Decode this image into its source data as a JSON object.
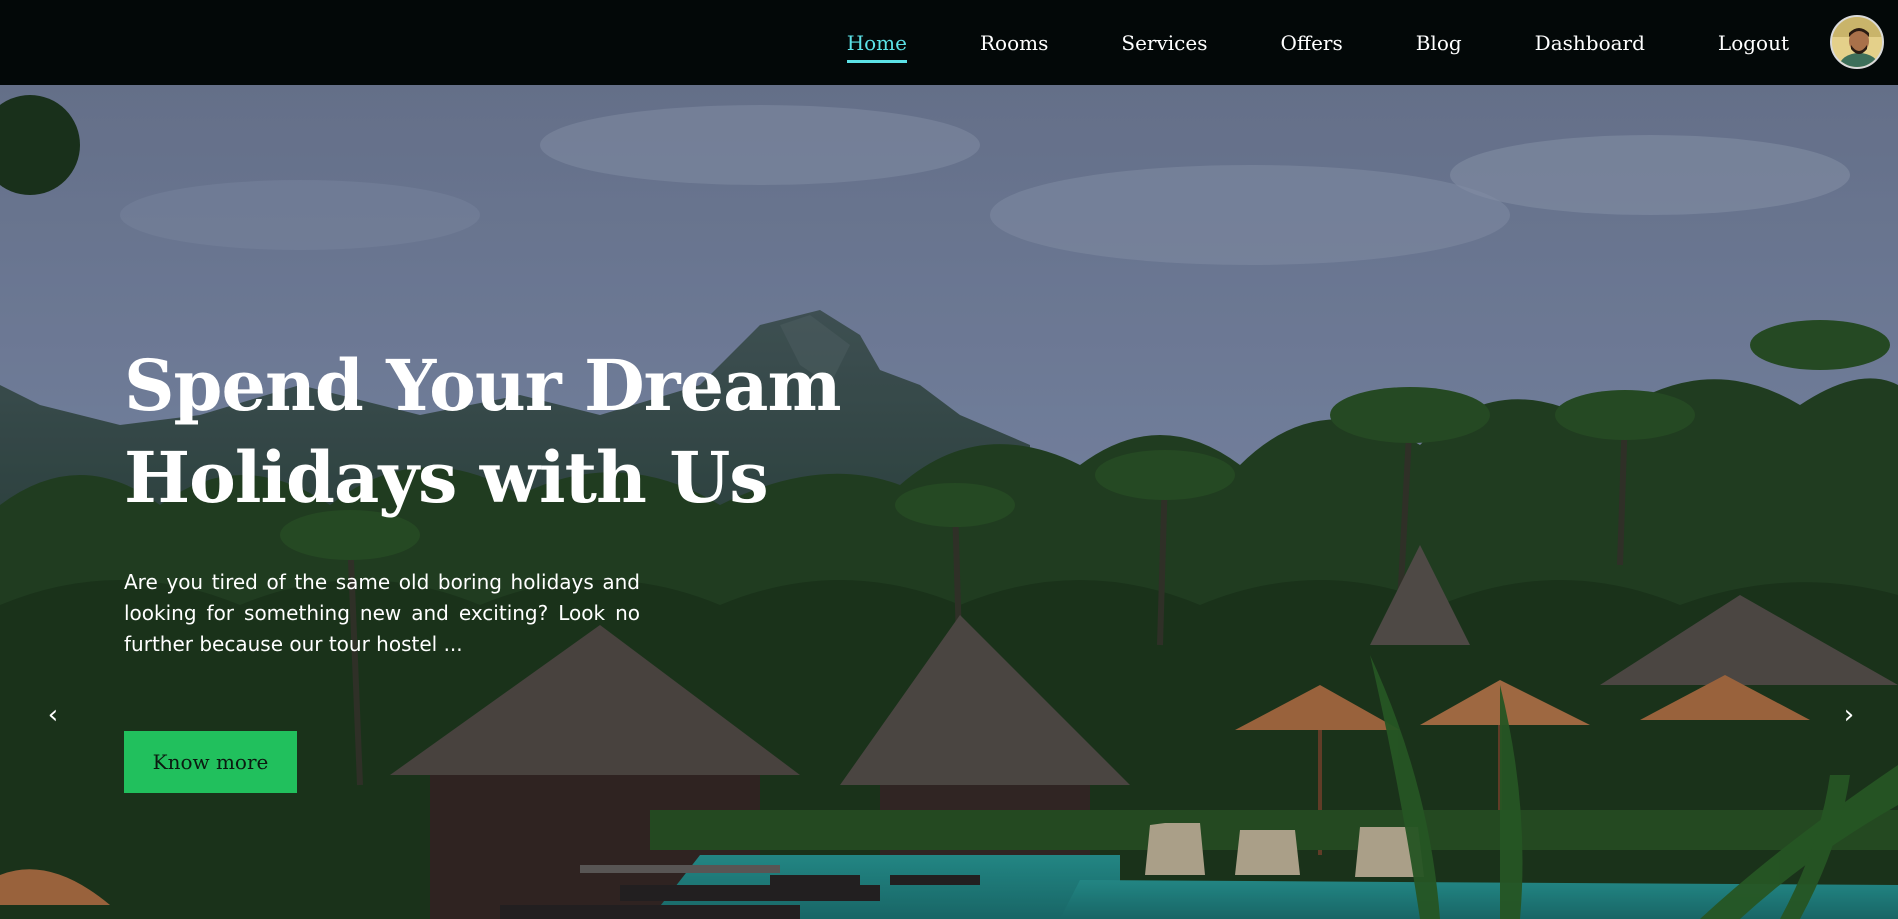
{
  "nav": {
    "items": [
      {
        "label": "Home",
        "active": true
      },
      {
        "label": "Rooms",
        "active": false
      },
      {
        "label": "Services",
        "active": false
      },
      {
        "label": "Offers",
        "active": false
      },
      {
        "label": "Blog",
        "active": false
      },
      {
        "label": "Dashboard",
        "active": false
      },
      {
        "label": "Logout",
        "active": false
      }
    ],
    "avatar_icon": "user-avatar-icon"
  },
  "hero": {
    "title_line1": "Spend Your Dream",
    "title_line2": "Holidays with Us",
    "description": "Are you tired of the same old boring holidays and looking for something new and exciting? Look no further because our tour hostel ...",
    "cta_label": "Know more",
    "prev_arrow": "‹",
    "next_arrow": "›"
  },
  "colors": {
    "navbar_bg": "#030808",
    "active_link": "#5ce1e6",
    "cta_bg": "#21c05d",
    "text": "#ffffff"
  }
}
